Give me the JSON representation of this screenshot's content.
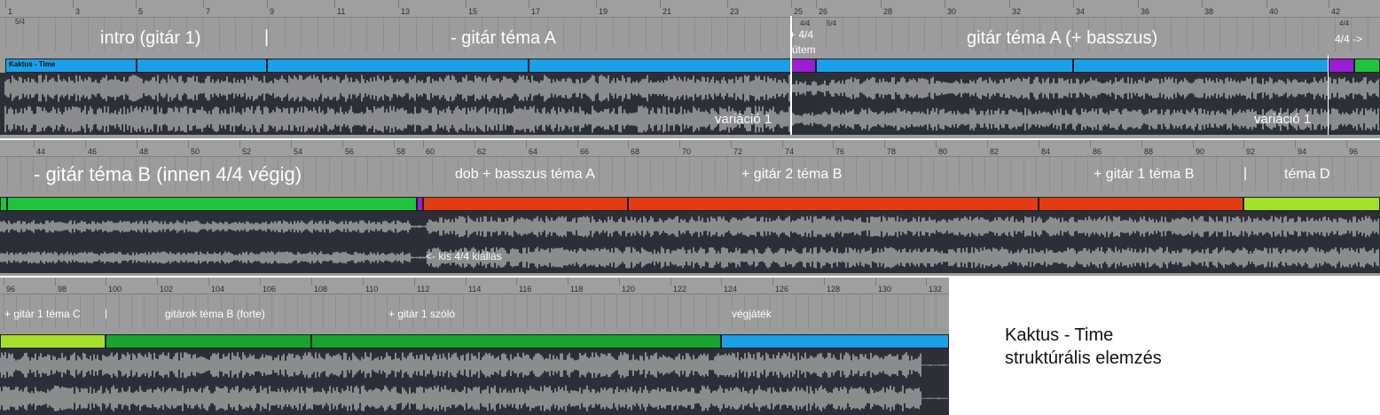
{
  "accent_colors": {
    "blue": "#1aa0e8",
    "purple": "#9c1ed2",
    "green": "#1fc43c",
    "red": "#e23d12",
    "lime": "#a4e02a",
    "dark_green": "#19a42c",
    "waveform_bg": "#2b2f38",
    "waveform": "#b4b4b4",
    "ruler": "#9f9f9f"
  },
  "strips": [
    {
      "id": "row1",
      "ruler": {
        "bars": [
          "1",
          "3",
          "5",
          "7",
          "9",
          "11",
          "13",
          "15",
          "17",
          "19",
          "21",
          "23",
          "25",
          "26",
          "28",
          "30",
          "32",
          "34",
          "36",
          "38",
          "40",
          "42"
        ],
        "signatures": [
          {
            "text": "5/4"
          },
          {
            "text": "4/4"
          },
          {
            "text": "5/4"
          },
          {
            "text": "4/4"
          }
        ]
      },
      "section_labels": [
        {
          "text": "intro (gitár 1)"
        },
        {
          "text": "|"
        },
        {
          "text": "- gitár téma A"
        },
        {
          "text": "+ 4/4"
        },
        {
          "text": "ütem"
        },
        {
          "text": "gitár téma A (+ basszus)"
        },
        {
          "text": "4/4 ->"
        }
      ],
      "clip_title": "Kaktus - Time",
      "wave_labels": [
        {
          "text": "variáció 1"
        },
        {
          "text": "variáció 1"
        }
      ]
    },
    {
      "id": "row2",
      "ruler": {
        "bars": [
          "44",
          "46",
          "48",
          "50",
          "52",
          "54",
          "56",
          "58",
          "60",
          "62",
          "64",
          "66",
          "68",
          "70",
          "72",
          "74",
          "76",
          "78",
          "80",
          "82",
          "84",
          "86",
          "88",
          "90",
          "92",
          "94",
          "96"
        ],
        "signatures": []
      },
      "section_labels": [
        {
          "text": "- gitár téma B (innen 4/4 végig)"
        },
        {
          "text": "dob + basszus téma A"
        },
        {
          "text": "+ gitár 2 téma B"
        },
        {
          "text": "+ gitár 1 téma B"
        },
        {
          "text": "|"
        },
        {
          "text": "téma D"
        }
      ],
      "wave_labels": [
        {
          "text": "<- kis 4/4 kiállás"
        }
      ]
    },
    {
      "id": "row3",
      "ruler": {
        "bars": [
          "96",
          "98",
          "100",
          "102",
          "104",
          "106",
          "108",
          "110",
          "112",
          "114",
          "116",
          "118",
          "120",
          "122",
          "124",
          "126",
          "128",
          "130",
          "132"
        ],
        "signatures": []
      },
      "section_labels": [
        {
          "text": "+ gitár 1 téma C"
        },
        {
          "text": "|"
        },
        {
          "text": "gitárok téma B (forte)"
        },
        {
          "text": "+ gitár 1 szóló"
        },
        {
          "text": "végjáték"
        }
      ],
      "wave_labels": []
    }
  ],
  "caption": {
    "line1": "Kaktus - Time",
    "line2": "struktúrális elemzés"
  }
}
